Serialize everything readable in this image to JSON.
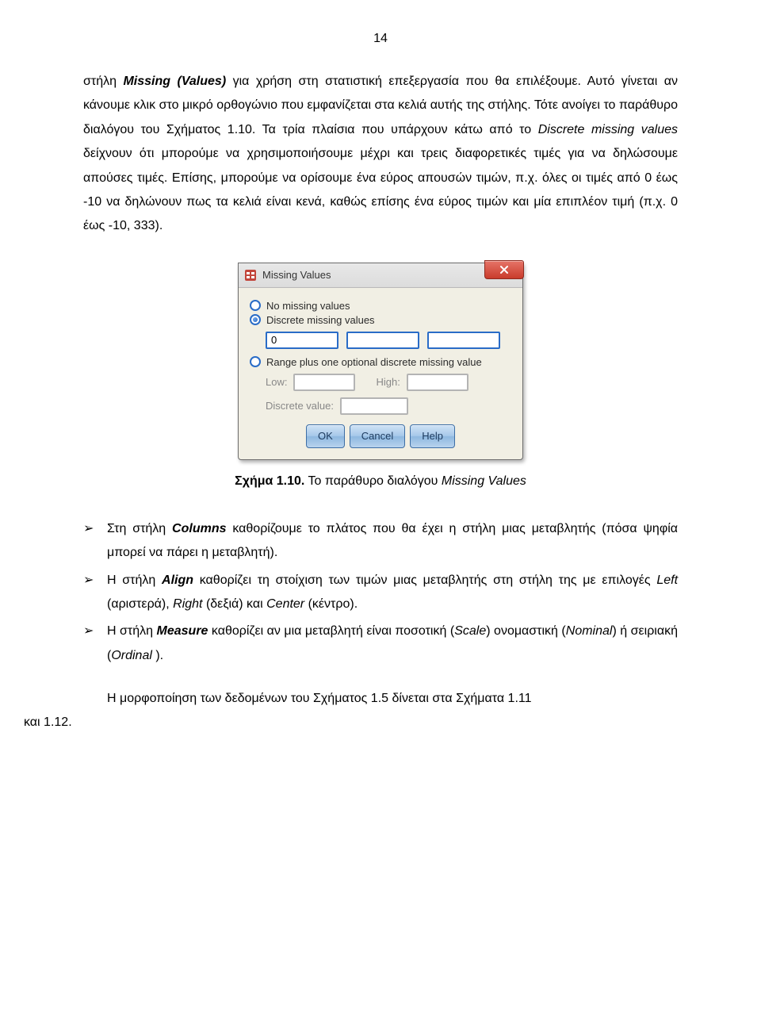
{
  "page_number": "14",
  "para1_pre": "στήλη ",
  "para1_missing": "Missing (Values)",
  "para1_rest": " για χρήση στη στατιστική επεξεργασία που θα επιλέξουμε. Αυτό γίνεται αν κάνουμε κλικ στο μικρό ορθογώνιο που εμφανίζεται στα κελιά αυτής της στήλης. Τότε ανοίγει το παράθυρο διαλόγου του Σχήματος 1.10. Τα τρία πλαίσια που υπάρχουν κάτω από το ",
  "para1_discrete": "Discrete missing values",
  "para1_after": " δείχνουν ότι μπορούμε να χρησιμοποιήσουμε μέχρι και τρεις διαφορετικές τιμές για να δηλώσουμε απούσες τιμές. Επίσης, μπορούμε να ορίσουμε ένα εύρος απουσών τιμών, π.χ. όλες οι τιμές από 0 έως -10 να δηλώνουν πως τα κελιά είναι κενά, καθώς επίσης ένα εύρος τιμών και μία επιπλέον τιμή (π.χ. 0 έως -10, 333).",
  "dialog": {
    "title": "Missing Values",
    "radio_none": "No missing values",
    "radio_discrete": "Discrete missing values",
    "radio_range": "Range plus one optional discrete missing value",
    "field_value": "0",
    "low_label": "Low:",
    "high_label": "High:",
    "dv_label": "Discrete value:",
    "ok": "OK",
    "cancel": "Cancel",
    "help": "Help"
  },
  "caption_bold": "Σχήμα 1.10.",
  "caption_rest": " Το παράθυρο διαλόγου ",
  "caption_ital": "Missing Values",
  "bullets": {
    "b1_pre": "Στη στήλη ",
    "b1_bold": "Columns",
    "b1_rest": " καθορίζουμε το πλάτος που θα έχει η στήλη μιας μεταβλητής (πόσα ψηφία μπορεί να πάρει η μεταβλητή).",
    "b2_pre": "Η στήλη ",
    "b2_bold": "Align",
    "b2_mid": " καθορίζει τη στοίχιση των τιμών μιας μεταβλητής στη στήλη της με επιλογές ",
    "b2_left": "Left",
    "b2_leftgr": " (αριστερά), ",
    "b2_right": "Right",
    "b2_rightgr": " (δεξιά) και ",
    "b2_center": "Center",
    "b2_centergr": " (κέντρο).",
    "b3_pre": "Η στήλη ",
    "b3_bold": "Measure",
    "b3_mid": " καθορίζει αν μια μεταβλητή είναι ποσοτική (",
    "b3_scale": "Scale",
    "b3_after1": ") ονομαστική (",
    "b3_nominal": "Nominal",
    "b3_after2": ") ή σειριακή (",
    "b3_ordinal": "Ordinal",
    "b3_after3": " ).",
    "marker": "➢"
  },
  "final_line1": "Η μορφοποίηση των δεδομένων του Σχήματος 1.5 δίνεται στα Σχήματα 1.11",
  "final_line2": "και 1.12."
}
